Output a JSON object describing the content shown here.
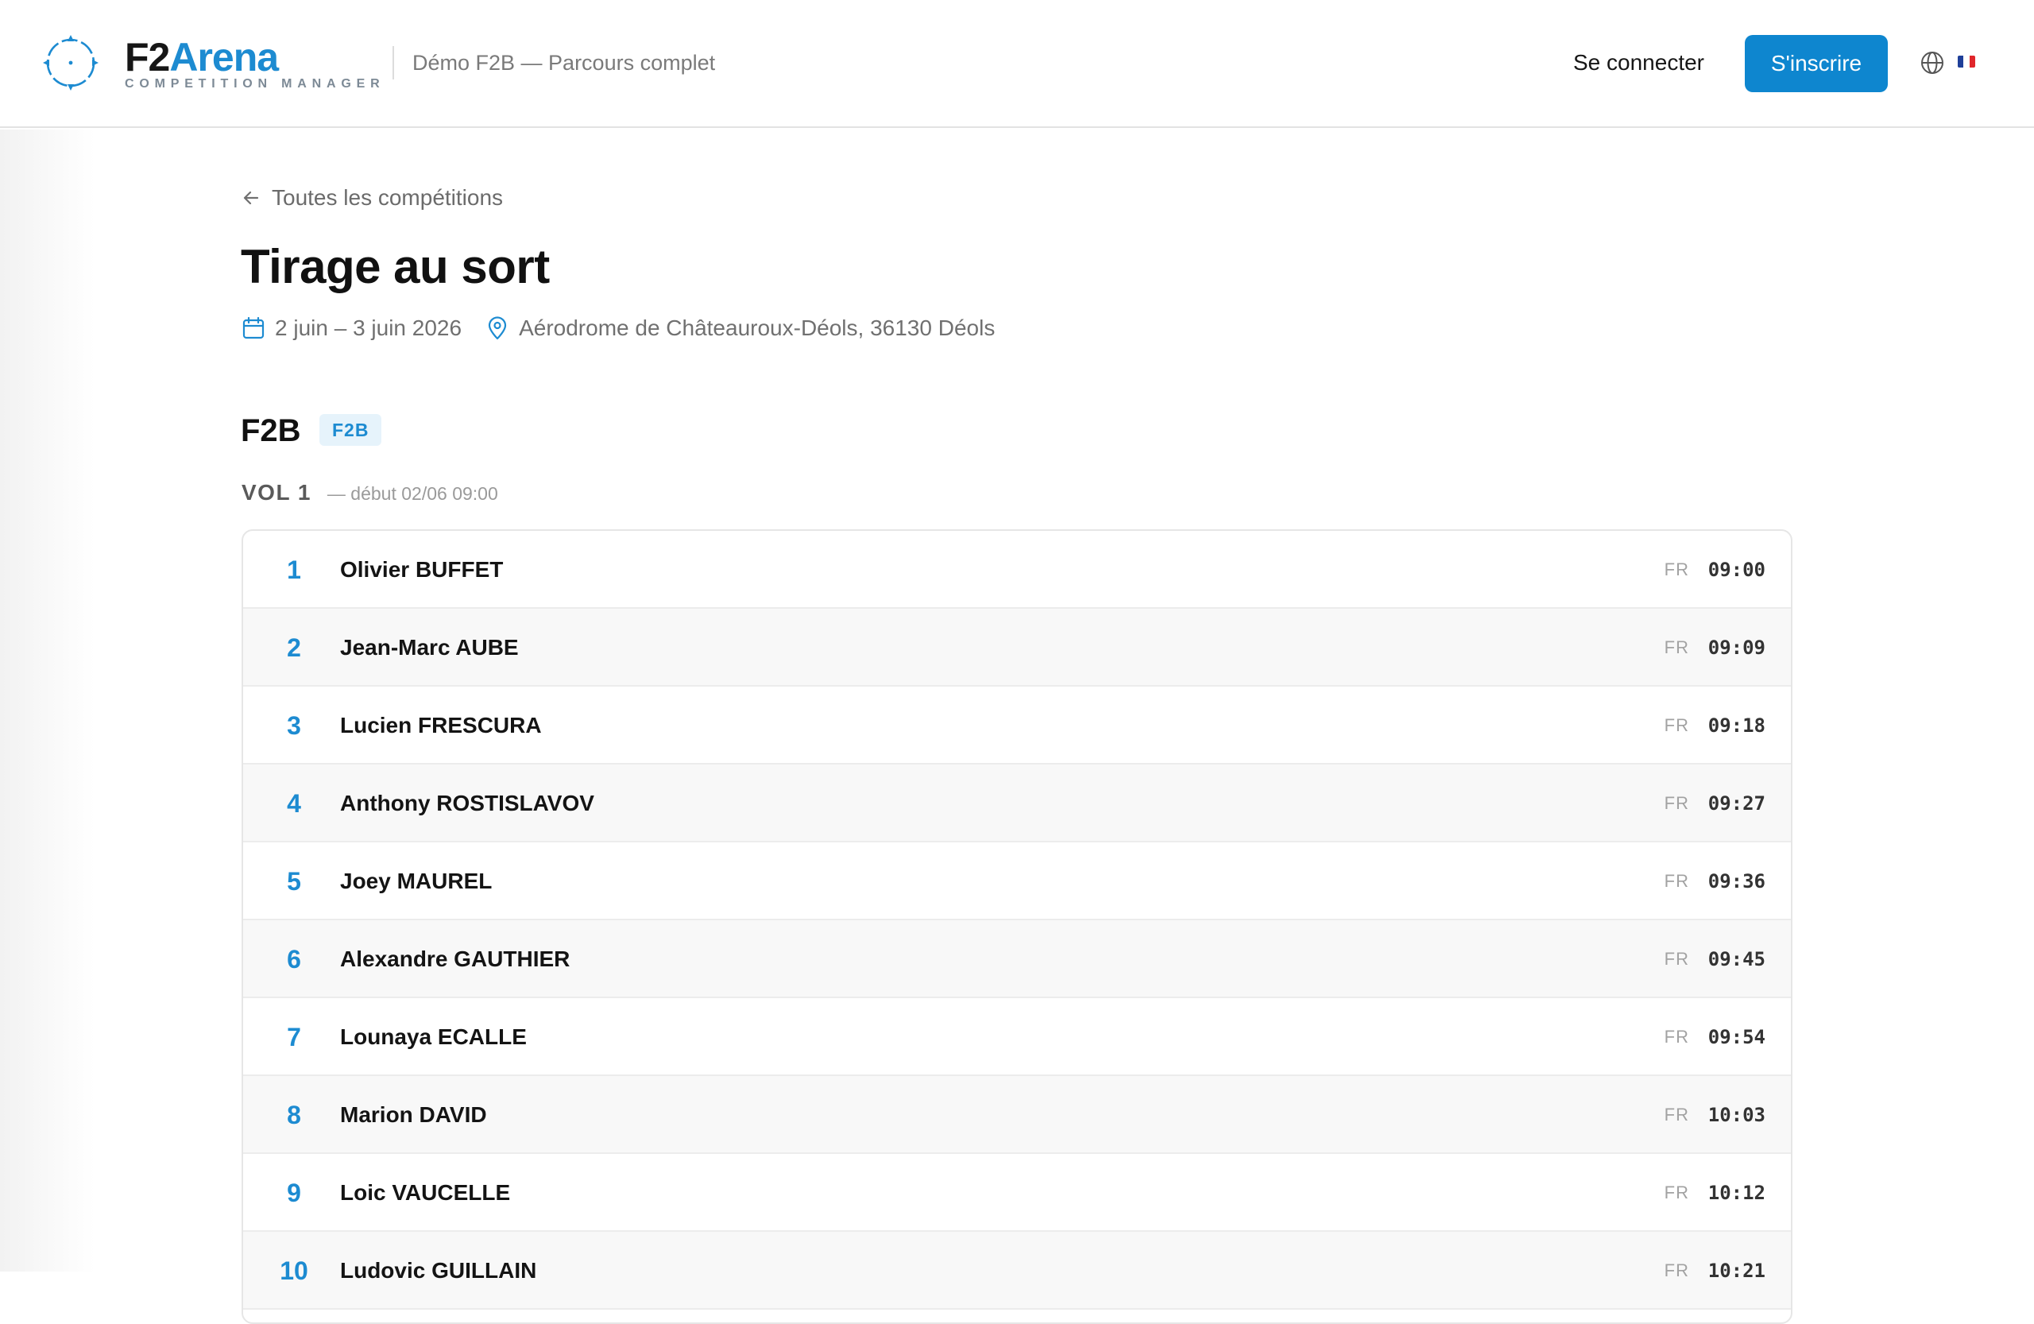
{
  "header": {
    "brand_primary": "F2",
    "brand_secondary": "Arena",
    "brand_subtitle": "COMPETITION MANAGER",
    "context_title": "Démo F2B — Parcours complet",
    "login_label": "Se connecter",
    "signup_label": "S'inscrire",
    "language_icon": "globe-icon",
    "language_flag": "flag-fr-icon"
  },
  "colors": {
    "accent": "#0e86cf",
    "brand_blue": "#1d8bd1",
    "flag_blue": "#1f3f99",
    "flag_white": "#ffffff",
    "flag_red": "#e0262b"
  },
  "page": {
    "back_label": "Toutes les compétitions",
    "title": "Tirage au sort",
    "dates": "2 juin – 3 juin 2026",
    "location": "Aérodrome de Châteauroux-Déols, 36130 Déols"
  },
  "section": {
    "title": "F2B",
    "badge": "F2B",
    "round_label": "VOL 1",
    "round_start": "— début 02/06 09:00"
  },
  "draw": [
    {
      "order": "1",
      "name": "Olivier BUFFET",
      "country": "FR",
      "time": "09:00"
    },
    {
      "order": "2",
      "name": "Jean-Marc AUBE",
      "country": "FR",
      "time": "09:09"
    },
    {
      "order": "3",
      "name": "Lucien FRESCURA",
      "country": "FR",
      "time": "09:18"
    },
    {
      "order": "4",
      "name": "Anthony ROSTISLAVOV",
      "country": "FR",
      "time": "09:27"
    },
    {
      "order": "5",
      "name": "Joey MAUREL",
      "country": "FR",
      "time": "09:36"
    },
    {
      "order": "6",
      "name": "Alexandre GAUTHIER",
      "country": "FR",
      "time": "09:45"
    },
    {
      "order": "7",
      "name": "Lounaya ECALLE",
      "country": "FR",
      "time": "09:54"
    },
    {
      "order": "8",
      "name": "Marion DAVID",
      "country": "FR",
      "time": "10:03"
    },
    {
      "order": "9",
      "name": "Loic VAUCELLE",
      "country": "FR",
      "time": "10:12"
    },
    {
      "order": "10",
      "name": "Ludovic GUILLAIN",
      "country": "FR",
      "time": "10:21"
    }
  ]
}
